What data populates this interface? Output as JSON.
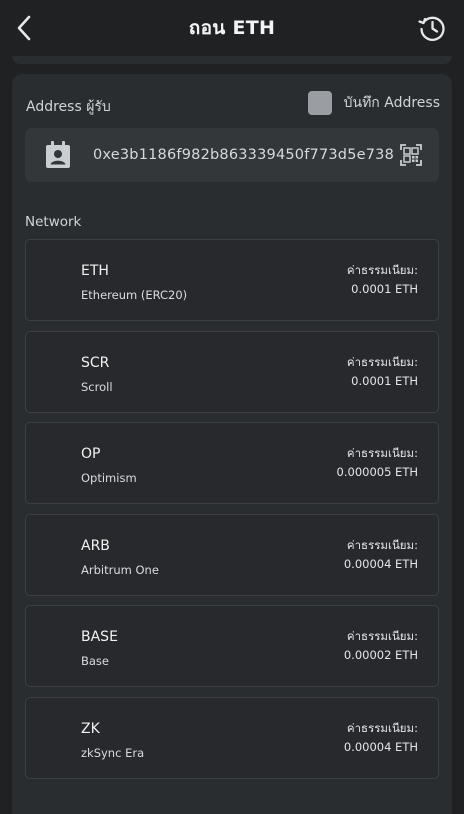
{
  "header": {
    "title": "ถอน ETH",
    "back_icon": "chevron-left-icon",
    "history_icon": "history-clock-icon"
  },
  "address": {
    "label": "Address ผู้รับ",
    "save_label": "บันทึก Address",
    "save_checked": false,
    "value": "0xe3b1186f982b863339450f773d5e738",
    "contact_icon": "contact-book-icon",
    "scan_icon": "qr-scan-icon"
  },
  "network": {
    "label": "Network",
    "items": [
      {
        "symbol": "ETH",
        "name": "Ethereum (ERC20)",
        "fee_label": "ค่าธรรมเนียม:",
        "fee": "0.0001 ETH"
      },
      {
        "symbol": "SCR",
        "name": "Scroll",
        "fee_label": "ค่าธรรมเนียม:",
        "fee": "0.0001 ETH"
      },
      {
        "symbol": "OP",
        "name": "Optimism",
        "fee_label": "ค่าธรรมเนียม:",
        "fee": "0.000005 ETH"
      },
      {
        "symbol": "ARB",
        "name": "Arbitrum One",
        "fee_label": "ค่าธรรมเนียม:",
        "fee": "0.00004 ETH"
      },
      {
        "symbol": "BASE",
        "name": "Base",
        "fee_label": "ค่าธรรมเนียม:",
        "fee": "0.00002 ETH"
      },
      {
        "symbol": "ZK",
        "name": "zkSync Era",
        "fee_label": "ค่าธรรมเนียม:",
        "fee": "0.00004 ETH"
      }
    ]
  }
}
